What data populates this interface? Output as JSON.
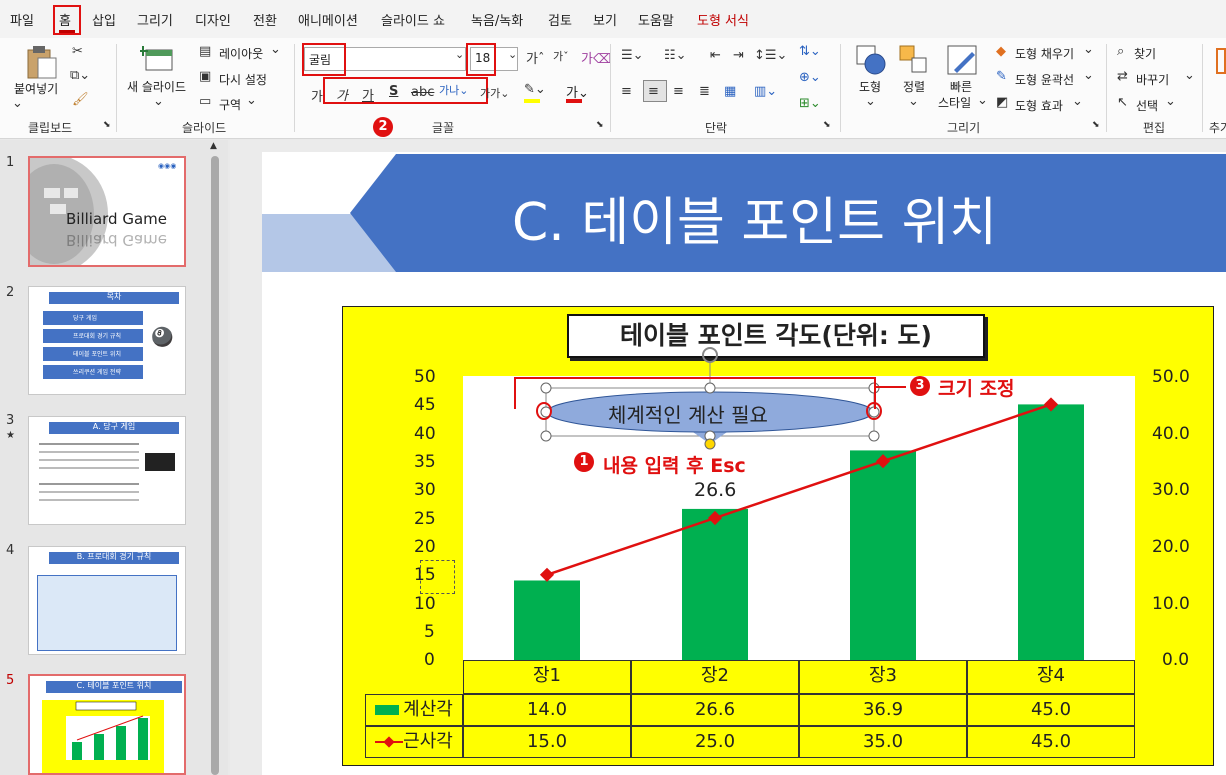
{
  "menu": {
    "tabs": [
      "파일",
      "홈",
      "삽입",
      "그리기",
      "디자인",
      "전환",
      "애니메이션",
      "슬라이드 쇼",
      "녹음/녹화",
      "검토",
      "보기",
      "도움말",
      "도형 서식"
    ]
  },
  "ribbon": {
    "clipboard": {
      "paste": "붙여넣기",
      "group": "클립보드"
    },
    "slides": {
      "new_slide": "새 슬라이드",
      "layout": "레이아웃",
      "reset": "다시 설정",
      "section": "구역",
      "group": "슬라이드"
    },
    "font": {
      "font_name": "굴림",
      "font_size": "18",
      "group": "글꼴"
    },
    "paragraph": {
      "group": "단락"
    },
    "drawing": {
      "shapes": "도형",
      "arrange": "정렬",
      "quick_styles_1": "빠른",
      "quick_styles_2": "스타일",
      "fill": "도형 채우기",
      "outline": "도형 윤곽선",
      "effects": "도형 효과",
      "group": "그리기"
    },
    "editing": {
      "find": "찾기",
      "replace": "바꾸기",
      "select": "선택",
      "group": "편집"
    },
    "extra": {
      "group": "추가"
    }
  },
  "thumbnails": [
    {
      "num": "1",
      "title": "Billiard Game"
    },
    {
      "num": "2",
      "title": "목차",
      "items": [
        "당구 게임",
        "프로대회 경기 규칙",
        "테이블 포인트 위치",
        "쓰리쿠션 게임 전략"
      ]
    },
    {
      "num": "3",
      "title": "A. 당구 게임"
    },
    {
      "num": "4",
      "title": "B. 프로대회 경기 규칙"
    },
    {
      "num": "5",
      "title": "C. 테이블 포인트 위치"
    }
  ],
  "slide": {
    "title": "C. 테이블 포인트 위치"
  },
  "chart": {
    "title": "테이블 포인트 각도(단위: 도)",
    "callout": "체계적인 계산 필요"
  },
  "chart_data": {
    "type": "bar",
    "title": "테이블 포인트 각도(단위: 도)",
    "categories": [
      "장1",
      "장2",
      "장3",
      "장4"
    ],
    "series": [
      {
        "name": "계산각",
        "type": "bar",
        "values": [
          14.0,
          26.6,
          36.9,
          45.0
        ],
        "color": "#00b050"
      },
      {
        "name": "근사각",
        "type": "line",
        "values": [
          15.0,
          25.0,
          35.0,
          45.0
        ],
        "color": "#e01010"
      }
    ],
    "data_label": "26.6",
    "ylim": [
      0,
      50
    ],
    "yticks": [
      "0",
      "5",
      "10",
      "15",
      "20",
      "25",
      "30",
      "35",
      "40",
      "45",
      "50"
    ],
    "yticks_right": [
      "0.0",
      "10.0",
      "20.0",
      "30.0",
      "40.0",
      "50.0"
    ],
    "table": {
      "rows": [
        {
          "name": "계산각",
          "values": [
            "14.0",
            "26.6",
            "36.9",
            "45.0"
          ]
        },
        {
          "name": "근사각",
          "values": [
            "15.0",
            "25.0",
            "35.0",
            "45.0"
          ]
        }
      ]
    }
  },
  "annotations": {
    "badge1": "1",
    "text1": "내용 입력 후 Esc",
    "badge2": "2",
    "badge3": "3",
    "text3": "크기 조정"
  },
  "colors": {
    "accent": "#c00000",
    "banner": "#4472c4",
    "chart_bg": "#ffff00",
    "bar": "#00b050",
    "line": "#e01010"
  }
}
